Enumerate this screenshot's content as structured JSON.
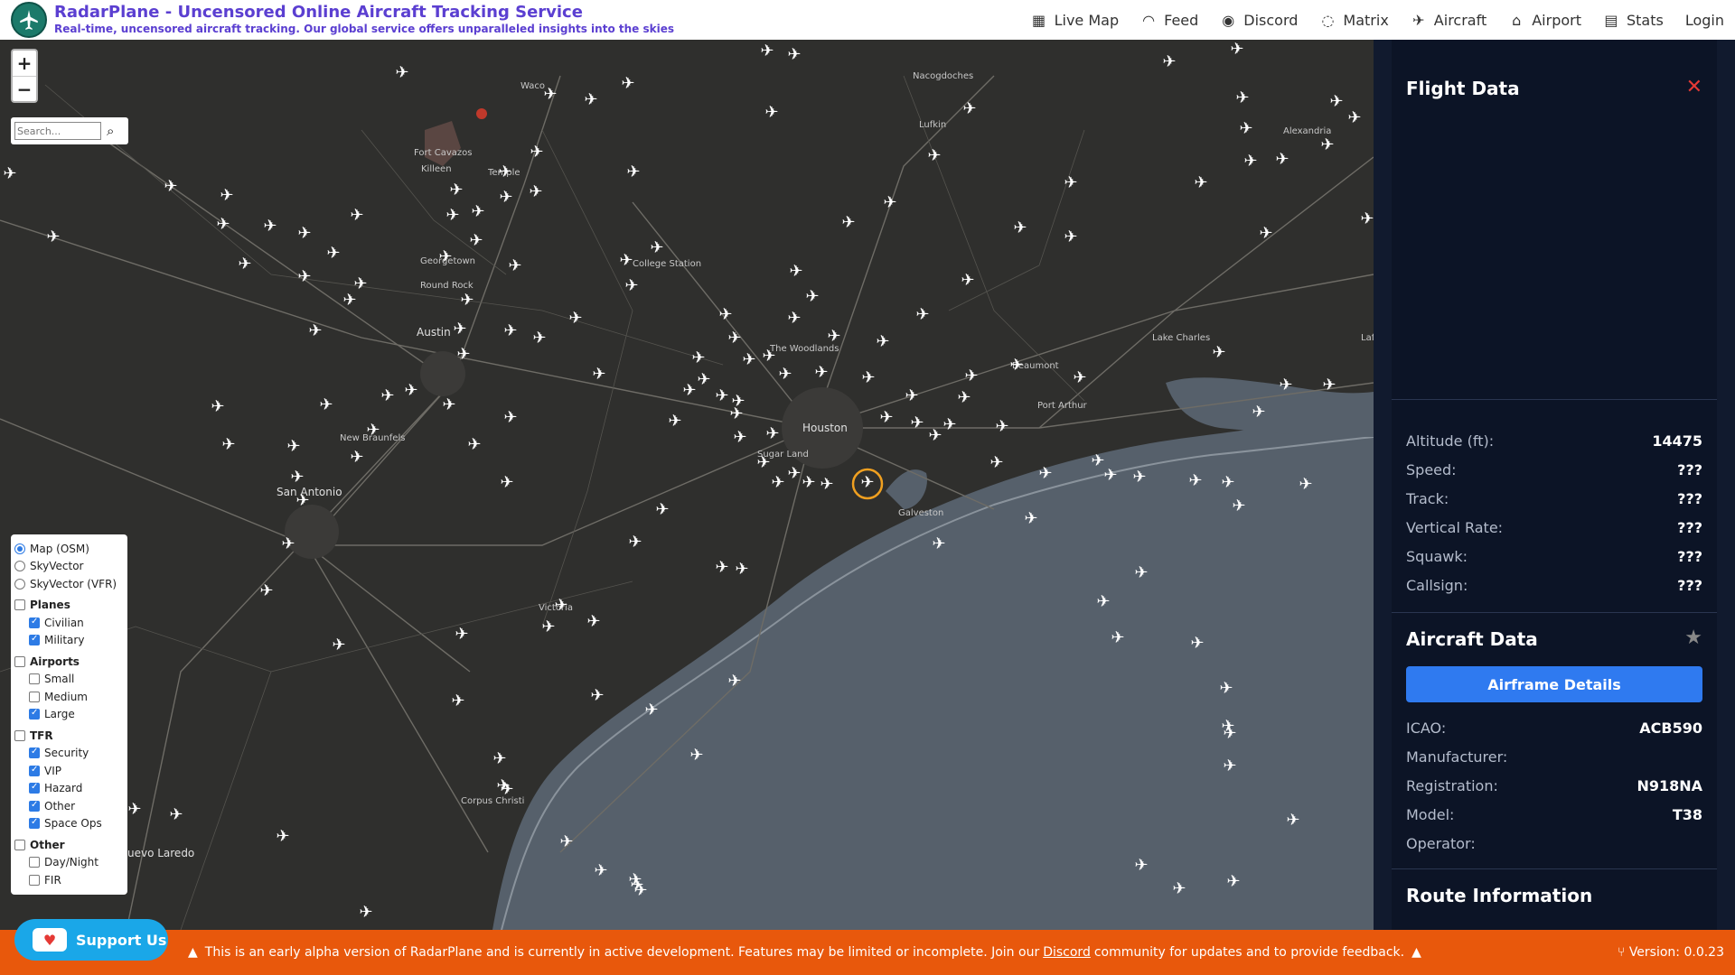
{
  "header": {
    "title": "RadarPlane - Uncensored Online Aircraft Tracking Service",
    "subtitle": "Real-time, uncensored aircraft tracking. Our global service offers unparalleled insights into the skies",
    "nav": [
      {
        "label": "Live Map",
        "icon": "map-icon"
      },
      {
        "label": "Feed",
        "icon": "rss-icon"
      },
      {
        "label": "Discord",
        "icon": "discord-icon"
      },
      {
        "label": "Matrix",
        "icon": "chat-icon"
      },
      {
        "label": "Aircraft",
        "icon": "plane-icon"
      },
      {
        "label": "Airport",
        "icon": "home-icon"
      },
      {
        "label": "Stats",
        "icon": "chart-icon"
      },
      {
        "label": "Login",
        "icon": ""
      }
    ]
  },
  "map": {
    "zoom_in": "+",
    "zoom_out": "−",
    "search_placeholder": "Search...",
    "places": [
      "Waco",
      "Nacogdoches",
      "Lufkin",
      "Alexandria",
      "Fort Cavazos",
      "Killeen",
      "Temple",
      "College Station",
      "Georgetown",
      "Round Rock",
      "Austin",
      "The Woodlands",
      "Houston",
      "Sugar Land",
      "Beaumont",
      "Lake Charles",
      "Port Arthur",
      "Galveston",
      "New Braunfels",
      "San Antonio",
      "Victoria",
      "Corpus Christi",
      "Nuevo Laredo",
      "Lafa"
    ]
  },
  "layers": {
    "base": [
      {
        "label": "Map (OSM)",
        "selected": true
      },
      {
        "label": "SkyVector",
        "selected": false
      },
      {
        "label": "SkyVector (VFR)",
        "selected": false
      }
    ],
    "groups": [
      {
        "label": "Planes",
        "checked": false,
        "items": [
          {
            "label": "Civilian",
            "checked": true
          },
          {
            "label": "Military",
            "checked": true
          }
        ]
      },
      {
        "label": "Airports",
        "checked": false,
        "items": [
          {
            "label": "Small",
            "checked": false
          },
          {
            "label": "Medium",
            "checked": false
          },
          {
            "label": "Large",
            "checked": true
          }
        ]
      },
      {
        "label": "TFR",
        "checked": false,
        "items": [
          {
            "label": "Security",
            "checked": true
          },
          {
            "label": "VIP",
            "checked": true
          },
          {
            "label": "Hazard",
            "checked": true
          },
          {
            "label": "Other",
            "checked": true
          },
          {
            "label": "Space Ops",
            "checked": true
          }
        ]
      },
      {
        "label": "Other",
        "checked": false,
        "items": [
          {
            "label": "Day/Night",
            "checked": false
          },
          {
            "label": "FIR",
            "checked": false
          }
        ]
      }
    ]
  },
  "panel": {
    "flight_title": "Flight Data",
    "close": "✕",
    "flight": [
      {
        "label": "Altitude (ft):",
        "value": "14475"
      },
      {
        "label": "Speed:",
        "value": "???"
      },
      {
        "label": "Track:",
        "value": "???"
      },
      {
        "label": "Vertical Rate:",
        "value": "???"
      },
      {
        "label": "Squawk:",
        "value": "???"
      },
      {
        "label": "Callsign:",
        "value": "???"
      }
    ],
    "aircraft_title": "Aircraft Data",
    "airframe_button": "Airframe Details",
    "aircraft": [
      {
        "label": "ICAO:",
        "value": "ACB590"
      },
      {
        "label": "Manufacturer:",
        "value": ""
      },
      {
        "label": "Registration:",
        "value": "N918NA"
      },
      {
        "label": "Model:",
        "value": "T38"
      },
      {
        "label": "Operator:",
        "value": ""
      }
    ],
    "route_title": "Route Information"
  },
  "footer": {
    "support": "Support Us",
    "msg_pre": "This is an early alpha version of RadarPlane and is currently in active development. Features may be limited or incomplete. Join our",
    "msg_link": "Discord",
    "msg_post": "community for updates and to provide feedback.",
    "version": "Version: 0.0.23"
  },
  "colors": {
    "accent": "#2f7af0",
    "footer": "#e8580c",
    "brand": "#5b3fd1",
    "close": "#e53935"
  }
}
